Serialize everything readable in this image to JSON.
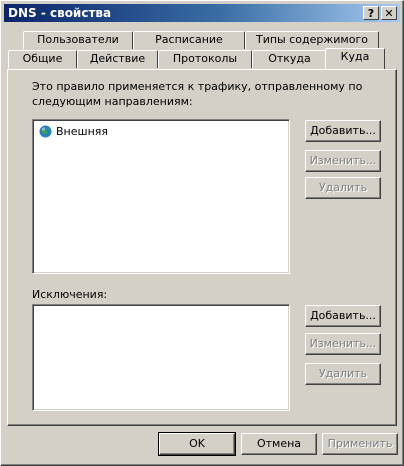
{
  "window": {
    "title": "DNS - свойства",
    "help_label": "?",
    "close_label": "✕"
  },
  "tabs": {
    "row1": [
      "Пользователи",
      "Расписание",
      "Типы содержимого"
    ],
    "row2": [
      "Общие",
      "Действие",
      "Протоколы",
      "Откуда",
      "Куда"
    ],
    "active": "Куда"
  },
  "destination": {
    "description_line1": "Это правило применяется к трафику, отправленному по",
    "description_line2": "следующим направлениям:",
    "items": [
      {
        "label": "Внешняя",
        "icon": "globe-icon"
      }
    ],
    "add_label": "Добавить...",
    "edit_label": "Изменить...",
    "remove_label": "Удалить"
  },
  "exceptions": {
    "label": "Исключения:",
    "items": [],
    "add_label": "Добавить...",
    "edit_label": "Изменить...",
    "remove_label": "Удалить"
  },
  "footer": {
    "ok_label": "OK",
    "cancel_label": "Отмена",
    "apply_label": "Применить"
  }
}
